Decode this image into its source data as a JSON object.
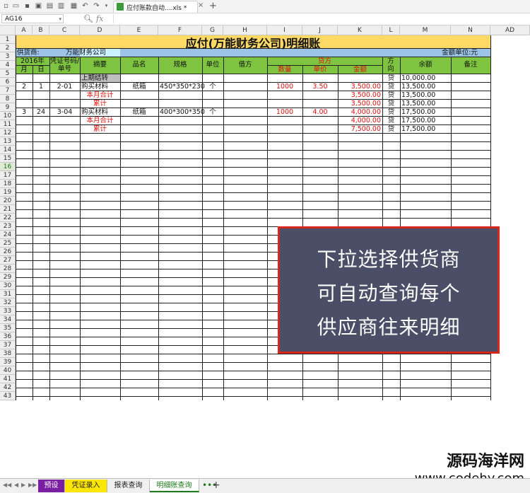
{
  "toolbar": {
    "file_tab": "应付账款自动....xls *",
    "close": "×",
    "new_tab": "+"
  },
  "formula_bar": {
    "cell_ref": "AG16",
    "fx": "fx",
    "value": ""
  },
  "columns": [
    "A",
    "B",
    "C",
    "D",
    "E",
    "F",
    "G",
    "H",
    "I",
    "J",
    "K",
    "L",
    "M",
    "N",
    "AD"
  ],
  "rows": [
    "1",
    "2",
    "3",
    "4",
    "5",
    "6",
    "7",
    "8",
    "9",
    "10",
    "11",
    "12",
    "13",
    "14",
    "15",
    "16",
    "17",
    "18",
    "19",
    "20",
    "21",
    "22",
    "23",
    "24",
    "25",
    "26",
    "27",
    "28",
    "29",
    "30",
    "31",
    "32",
    "33",
    "34",
    "35",
    "36",
    "37",
    "38",
    "39",
    "40",
    "41",
    "42",
    "43"
  ],
  "selected_row": "16",
  "sheet": {
    "title": "应付(万能财务公司)明细账",
    "supplier_label": "供货商:",
    "supplier_value": "万能财务公司",
    "unit_label": "金额单位:元",
    "headers": {
      "year": "2016年",
      "month": "月",
      "day": "日",
      "voucher": "凭证号码/单号",
      "summary": "摘要",
      "product": "品名",
      "spec": "规格",
      "unit": "单位",
      "debit": "借方",
      "credit": "贷方",
      "qty": "数量",
      "price": "单价",
      "amount": "金额",
      "direction": "方向",
      "balance": "余额",
      "note": "备注"
    },
    "data_rows": [
      {
        "month": "",
        "day": "",
        "voucher": "",
        "summary": "上期结转",
        "product": "",
        "spec": "",
        "unit": "",
        "debit": "",
        "qty": "",
        "price": "",
        "amount": "",
        "dir": "贷",
        "balance": "10,000.00",
        "red": false
      },
      {
        "month": "2",
        "day": "1",
        "voucher": "2-01",
        "summary": "购买材料",
        "product": "纸箱",
        "spec": "450*350*230",
        "unit": "个",
        "debit": "",
        "qty": "1000",
        "price": "3.50",
        "amount": "3,500.00",
        "dir": "贷",
        "balance": "13,500.00",
        "red": false
      },
      {
        "month": "",
        "day": "",
        "voucher": "",
        "summary": "本月合计",
        "product": "",
        "spec": "",
        "unit": "",
        "debit": "",
        "qty": "",
        "price": "",
        "amount": "3,500.00",
        "dir": "贷",
        "balance": "13,500.00",
        "red": true
      },
      {
        "month": "",
        "day": "",
        "voucher": "",
        "summary": "累计",
        "product": "",
        "spec": "",
        "unit": "",
        "debit": "",
        "qty": "",
        "price": "",
        "amount": "3,500.00",
        "dir": "贷",
        "balance": "13,500.00",
        "red": true
      },
      {
        "month": "3",
        "day": "24",
        "voucher": "3-04",
        "summary": "购买材料",
        "product": "纸箱",
        "spec": "400*300*350",
        "unit": "个",
        "debit": "",
        "qty": "1000",
        "price": "4.00",
        "amount": "4,000.00",
        "dir": "贷",
        "balance": "17,500.00",
        "red": false
      },
      {
        "month": "",
        "day": "",
        "voucher": "",
        "summary": "本月合计",
        "product": "",
        "spec": "",
        "unit": "",
        "debit": "",
        "qty": "",
        "price": "",
        "amount": "4,000.00",
        "dir": "贷",
        "balance": "17,500.00",
        "red": true
      },
      {
        "month": "",
        "day": "",
        "voucher": "",
        "summary": "累计",
        "product": "",
        "spec": "",
        "unit": "",
        "debit": "",
        "qty": "",
        "price": "",
        "amount": "7,500.00",
        "dir": "贷",
        "balance": "17,500.00",
        "red": true
      }
    ]
  },
  "overlay": {
    "lines": [
      "下拉选择供货商",
      "可自动查询每个",
      "供应商往来明细"
    ]
  },
  "watermark": {
    "line1": "源码海洋网",
    "line2": "www.codehy.com"
  },
  "sheet_tabs": [
    "预设",
    "凭证录入",
    "报表查询",
    "明细账查询"
  ],
  "sheet_more": "•••",
  "sheet_add": "+",
  "colors": {
    "title_bg": "#ffd966",
    "header_bg": "#7ec440",
    "supplier_bg": "#9dc3e6",
    "supplier_value_bg": "#ccf2ff",
    "carry_bg": "#bfbfbf",
    "red": "#e01010"
  }
}
